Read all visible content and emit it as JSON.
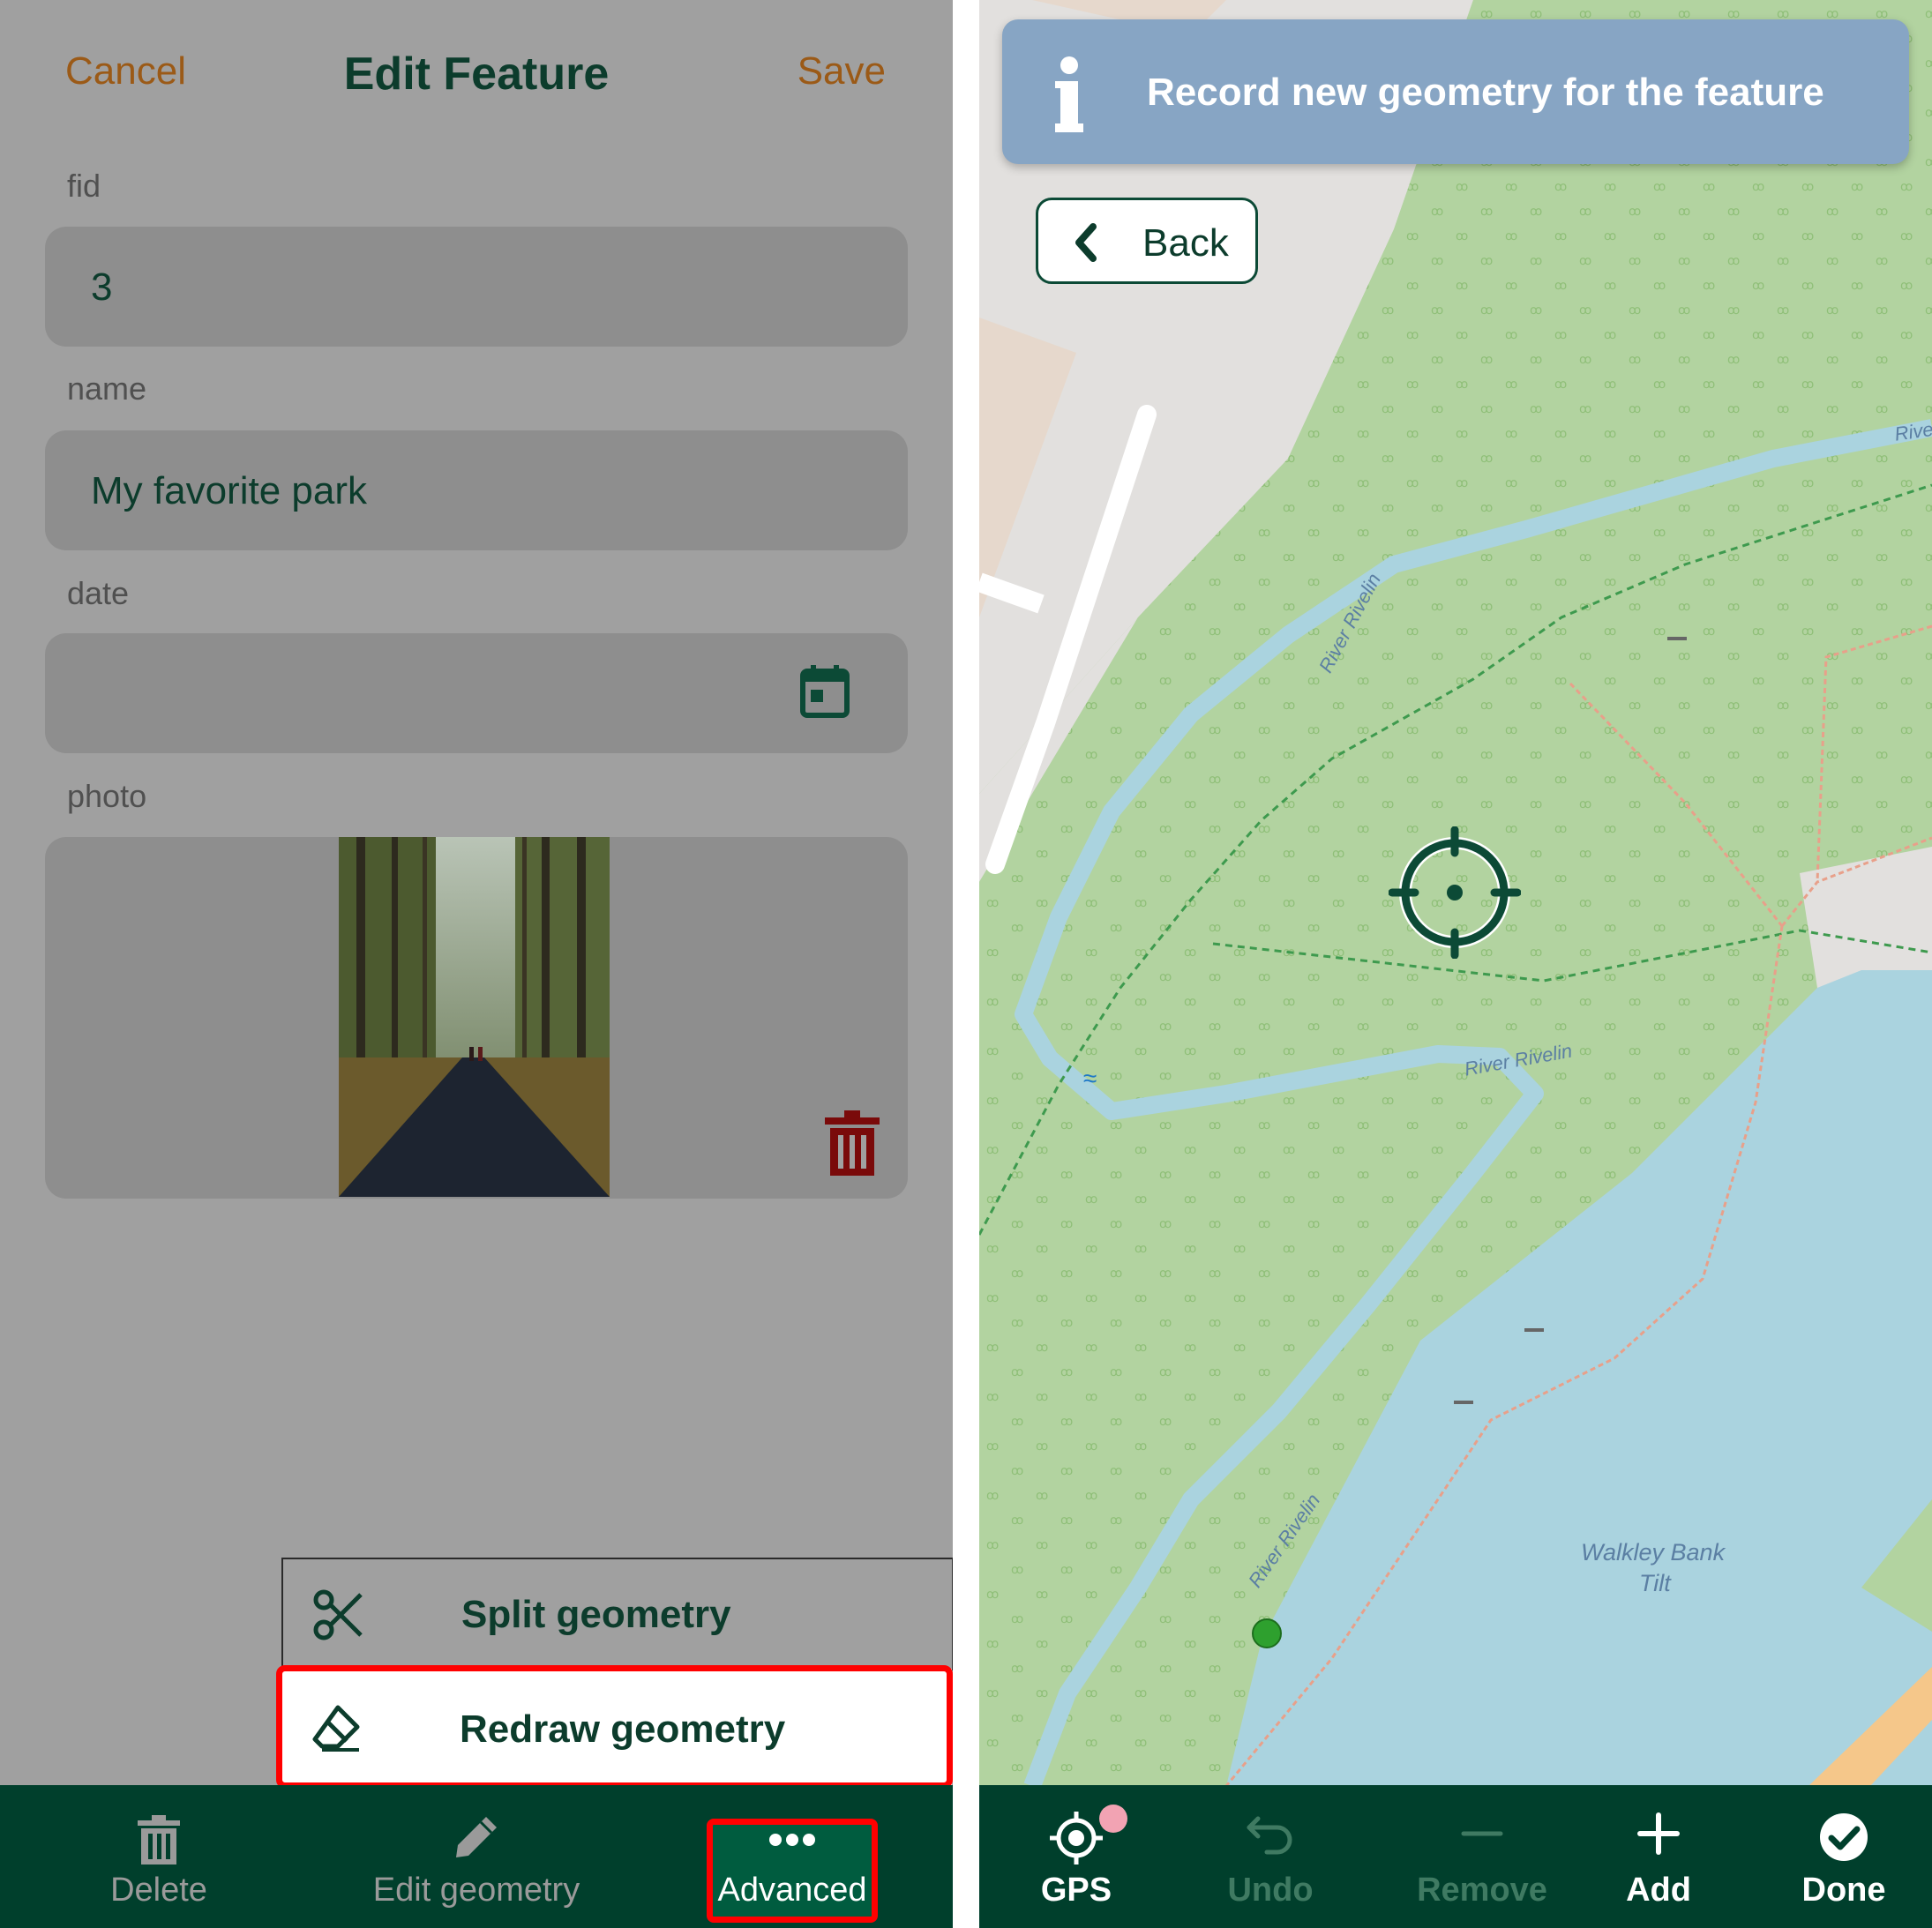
{
  "edit_form": {
    "cancel_label": "Cancel",
    "title": "Edit Feature",
    "save_label": "Save",
    "fields": [
      {
        "label": "fid",
        "value": "3"
      },
      {
        "label": "name",
        "value": "My favorite park"
      },
      {
        "label": "date",
        "value": ""
      },
      {
        "label": "photo",
        "value": ""
      }
    ],
    "date_icon": "calendar-icon",
    "photo_delete_icon": "trash-icon"
  },
  "advanced_menu": {
    "items": [
      {
        "label": "Split geometry",
        "icon": "scissors-icon"
      },
      {
        "label": "Redraw geometry",
        "icon": "eraser-icon",
        "highlighted": true
      }
    ]
  },
  "form_toolbar": {
    "buttons": [
      {
        "label": "Delete",
        "icon": "trash-icon"
      },
      {
        "label": "Edit geometry",
        "icon": "pencil-icon"
      },
      {
        "label": "Advanced",
        "icon": "more-dots-icon",
        "highlighted": true
      }
    ]
  },
  "map": {
    "banner_text": "Record new geometry for the feature",
    "banner_icon": "info-icon",
    "back_label": "Back",
    "labels": {
      "river_1": "River Rivelin",
      "river_2": "River Rivelin",
      "river_3": "River Rivelin",
      "river_4": "Rive",
      "reservoir_line1": "Walkley Bank",
      "reservoir_line2": "Tilt"
    }
  },
  "map_toolbar": {
    "buttons": [
      {
        "label": "GPS",
        "icon": "gps-icon",
        "enabled": true
      },
      {
        "label": "Undo",
        "icon": "undo-icon",
        "enabled": false
      },
      {
        "label": "Remove",
        "icon": "minus-icon",
        "enabled": false
      },
      {
        "label": "Add",
        "icon": "plus-icon",
        "enabled": true
      },
      {
        "label": "Done",
        "icon": "check-circle-icon",
        "enabled": true
      }
    ]
  },
  "colors": {
    "brand_dark": "#003f2c",
    "accent_orange": "#9b5a17",
    "banner_blue": "#87a5c4",
    "highlight_red": "#ff0000",
    "park_green": "#b2d3a0",
    "water_blue": "#aad3df"
  }
}
